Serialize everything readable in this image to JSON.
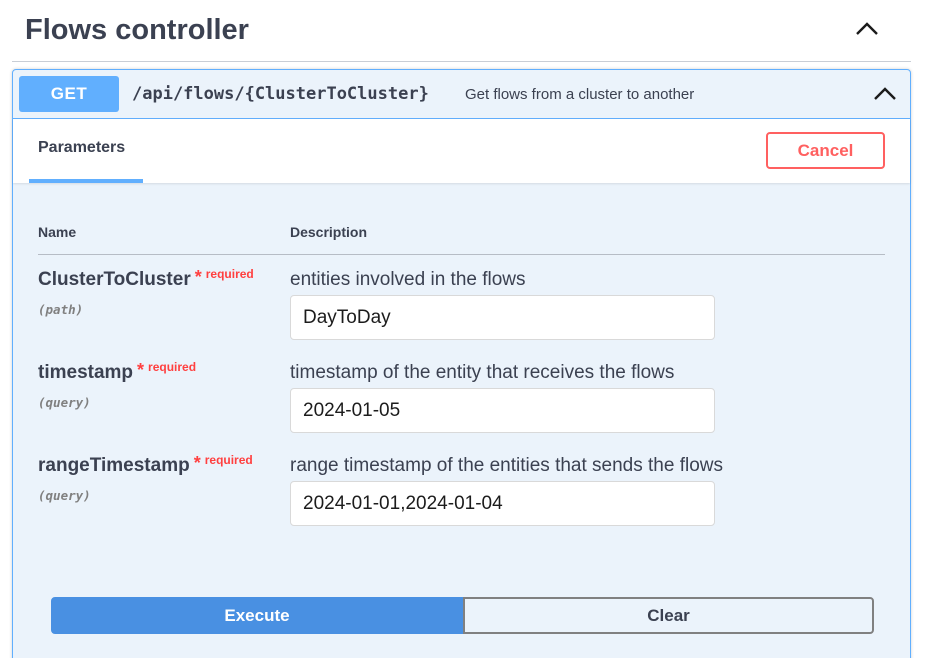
{
  "section": {
    "title": "Flows controller",
    "toggle_icon": "chevron-up-icon"
  },
  "operation": {
    "method": "GET",
    "path": "/api/flows/{ClusterToCluster}",
    "summary": "Get flows from a cluster to another",
    "toggle_icon": "chevron-up-icon",
    "accent_color": "#61affe"
  },
  "parameters_panel": {
    "tab_label": "Parameters",
    "cancel_label": "Cancel",
    "columns": {
      "name": "Name",
      "description": "Description"
    },
    "params": [
      {
        "name": "ClusterToCluster",
        "required_mark": "*",
        "required_label": "required",
        "in": "(path)",
        "description": "entities involved in the flows",
        "value": "DayToDay"
      },
      {
        "name": "timestamp",
        "required_mark": "*",
        "required_label": "required",
        "in": "(query)",
        "description": "timestamp of the entity that receives the flows",
        "value": "2024-01-05"
      },
      {
        "name": "rangeTimestamp",
        "required_mark": "*",
        "required_label": "required",
        "in": "(query)",
        "description": "range timestamp of the entities that sends the flows",
        "value": "2024-01-01,2024-01-04"
      }
    ]
  },
  "actions": {
    "execute_label": "Execute",
    "clear_label": "Clear",
    "execute_color": "#4990e2",
    "cancel_color": "#ff6060"
  }
}
